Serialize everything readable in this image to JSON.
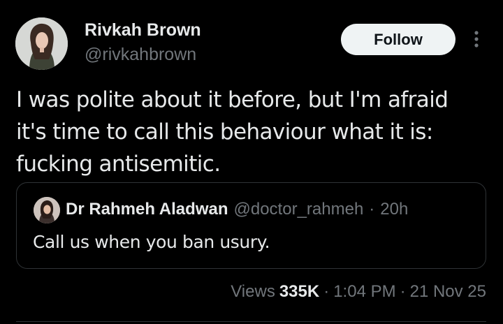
{
  "author": {
    "display_name": "Rivkah Brown",
    "handle": "@rivkahbrown"
  },
  "actions": {
    "follow_label": "Follow",
    "more_icon": "more-vertical-icon"
  },
  "tweet": {
    "lines": [
      "I was polite about it before, but I'm afraid",
      "it's time to call this behaviour what it is:",
      "fucking antisemitic."
    ]
  },
  "quoted_tweet": {
    "display_name": "Dr Rahmeh Aladwan",
    "handle": "@doctor_rahmeh",
    "separator": "·",
    "time_ago": "20h",
    "text": "Call us when you ban usury."
  },
  "meta": {
    "views_label": "Views",
    "views_count": "335K",
    "separator": "·",
    "time": "1:04 PM",
    "date": "21 Nov 25"
  },
  "colors": {
    "background": "#000000",
    "primary_text": "#e7e9ea",
    "secondary_text": "#71767b",
    "border": "#2f3336",
    "follow_bg": "#eff3f4"
  }
}
